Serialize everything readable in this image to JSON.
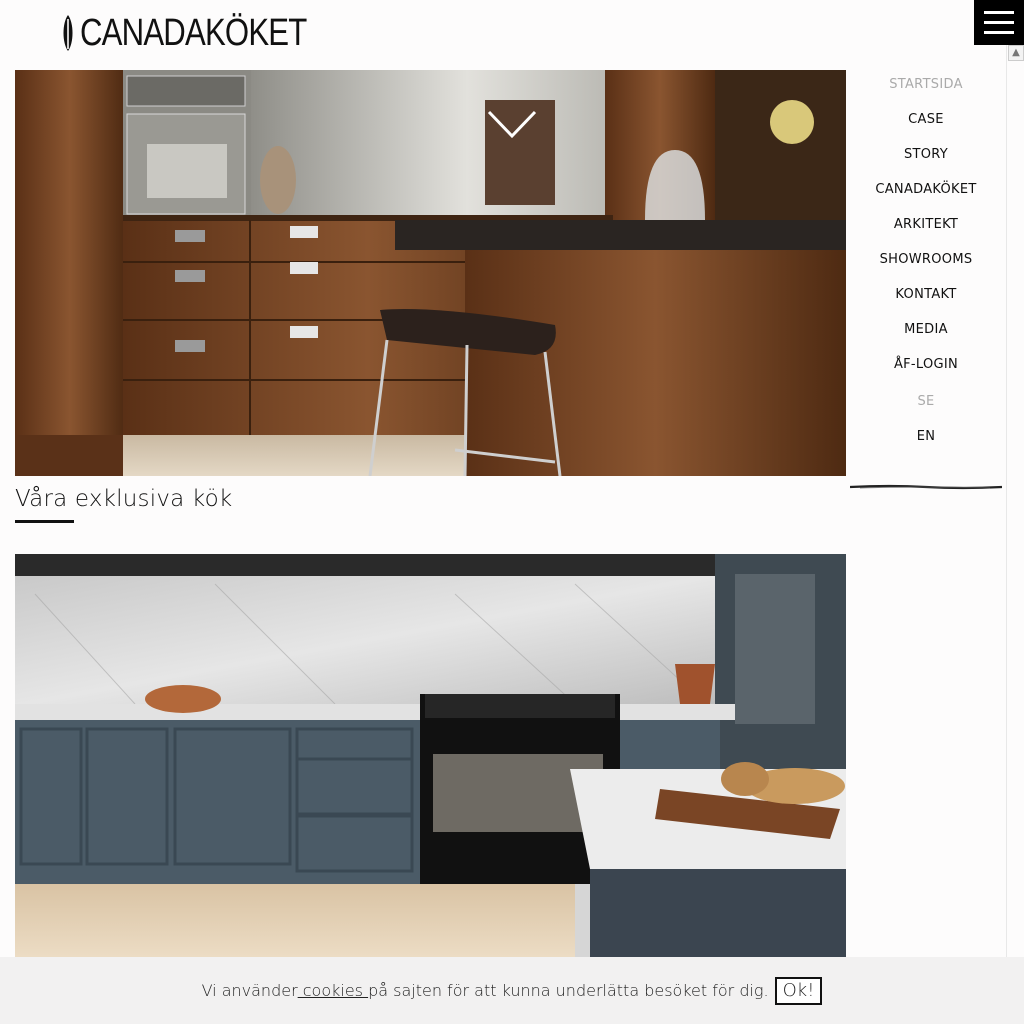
{
  "brand": {
    "name": "CANADAKÖKET"
  },
  "nav": {
    "items": [
      {
        "label": "STARTSIDA",
        "active": true
      },
      {
        "label": "CASE"
      },
      {
        "label": "STORY"
      },
      {
        "label": "CANADAKÖKET"
      },
      {
        "label": "ARKITEKT"
      },
      {
        "label": "SHOWROOMS"
      },
      {
        "label": "KONTAKT"
      },
      {
        "label": "MEDIA"
      },
      {
        "label": "ÅF-LOGIN"
      }
    ],
    "languages": [
      {
        "label": "SE",
        "active": true
      },
      {
        "label": "EN"
      }
    ]
  },
  "main": {
    "section_title": "Våra exklusiva kök"
  },
  "cookie": {
    "text_before": "Vi använder",
    "link": " cookies ",
    "text_after": "på sajten för att kunna underlätta besöket för dig.",
    "ok_label": "Ok!"
  },
  "icons": {
    "menu": "hamburger-menu-icon",
    "scroll_down": "chevron-down-icon",
    "scroll_up": "scroll-up-arrow-icon"
  },
  "colors": {
    "background": "#fdfcfc",
    "text": "#111111",
    "muted": "#aaaaaa",
    "walnut": "#7a4a2a",
    "cabinet_grey": "#4a5a66"
  }
}
